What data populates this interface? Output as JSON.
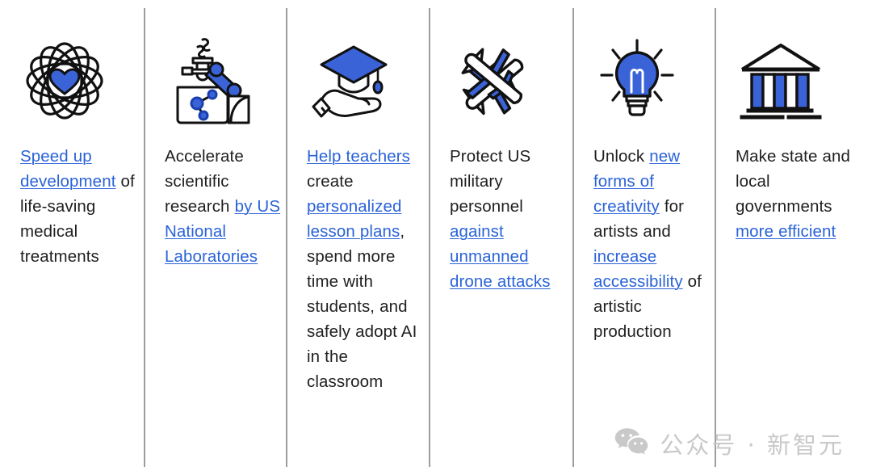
{
  "columns": [
    {
      "icon": "atom-heart-icon",
      "caption_parts": [
        {
          "text": "Speed up development",
          "link": true
        },
        {
          "text": " of life-saving medical treatments",
          "link": false
        }
      ]
    },
    {
      "icon": "lab-robot-arm-icon",
      "caption_parts": [
        {
          "text": "Accelerate scientific research ",
          "link": false
        },
        {
          "text": "by US National Laboratories",
          "link": true
        }
      ]
    },
    {
      "icon": "graduation-cap-hand-icon",
      "caption_parts": [
        {
          "text": "Help teachers",
          "link": true
        },
        {
          "text": " create ",
          "link": false
        },
        {
          "text": "personalized lesson plans",
          "link": true
        },
        {
          "text": ", spend more time with students, and safely adopt AI in the classroom",
          "link": false
        }
      ]
    },
    {
      "icon": "crossed-drones-icon",
      "caption_parts": [
        {
          "text": "Protect US military personnel ",
          "link": false
        },
        {
          "text": "against unmanned drone attacks",
          "link": true
        }
      ]
    },
    {
      "icon": "lightbulb-icon",
      "caption_parts": [
        {
          "text": "Unlock ",
          "link": false
        },
        {
          "text": "new forms of creativity",
          "link": true
        },
        {
          "text": " for artists and ",
          "link": false
        },
        {
          "text": "increase accessibility",
          "link": true
        },
        {
          "text": " of artistic production",
          "link": false
        }
      ]
    },
    {
      "icon": "bank-building-icon",
      "caption_parts": [
        {
          "text": "Make state and local governments ",
          "link": false
        },
        {
          "text": "more efficient",
          "link": true
        }
      ]
    }
  ],
  "watermark": {
    "icon": "wechat-icon",
    "text": "公众号 · 新智元"
  },
  "colors": {
    "link": "#2a63d8",
    "text": "#1f1f1f",
    "icon_blue": "#3b63d8",
    "divider": "#9e9e9e",
    "watermark": "#c9c9c9",
    "background": "#ffffff"
  }
}
